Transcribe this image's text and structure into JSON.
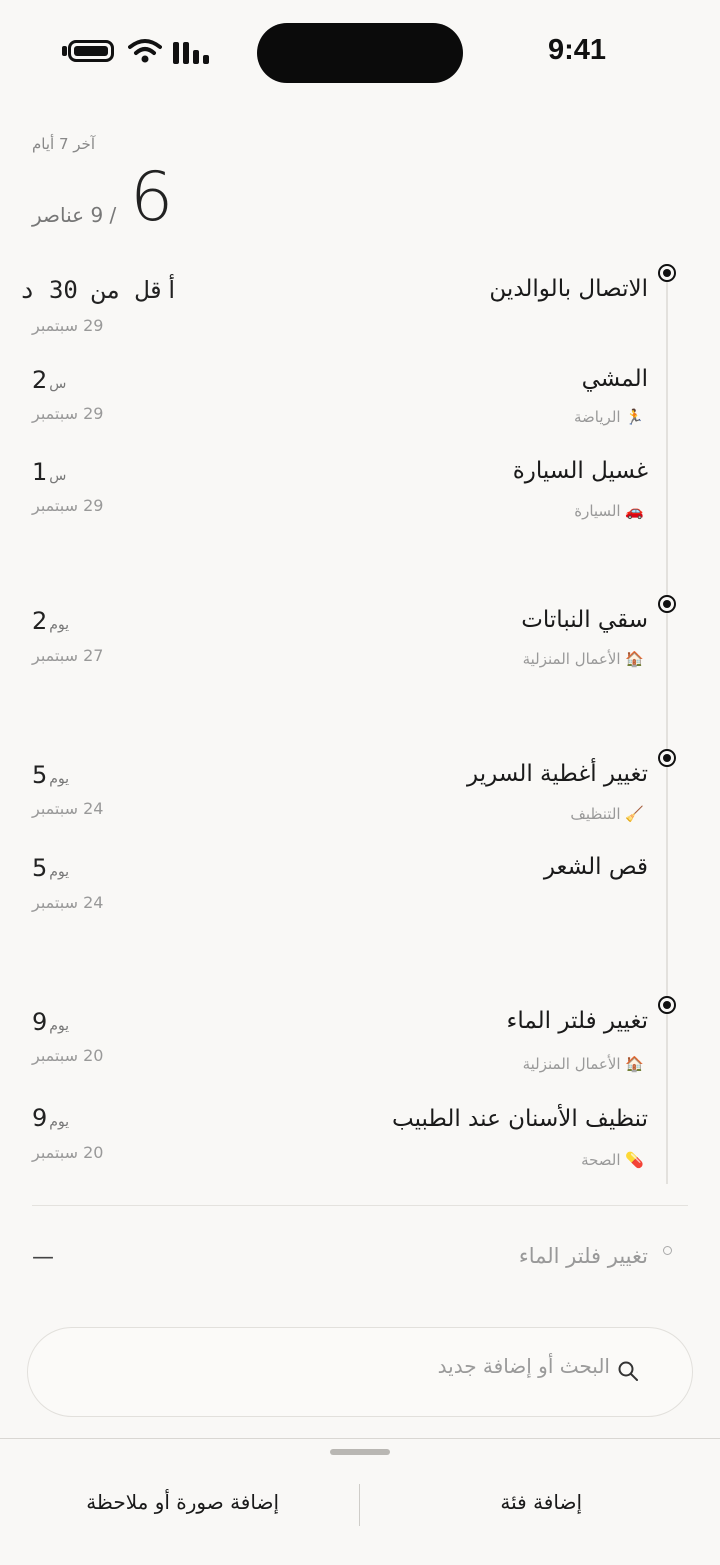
{
  "status_bar": {
    "time": "9:41"
  },
  "header": {
    "period_label": "آخر 7 أيام",
    "done_count": "6",
    "total_label": "/ 9 عناصر"
  },
  "entries": [
    {
      "title": "الاتصال بالوالدين",
      "category": "",
      "amount": "أقل من 30 د",
      "unit": "",
      "date": "29 سبتمبر"
    },
    {
      "title": "المشي",
      "category": "🏃 الرياضة",
      "amount": "2",
      "unit": "س",
      "date": "29 سبتمبر"
    },
    {
      "title": "غسيل السيارة",
      "category": "🚗 السيارة",
      "amount": "1",
      "unit": "س",
      "date": "29 سبتمبر"
    },
    {
      "title": "سقي النباتات",
      "category": "🏠 الأعمال المنزلية",
      "amount": "2",
      "unit": "يوم",
      "date": "27 سبتمبر"
    },
    {
      "title": "تغيير أغطية السرير",
      "category": "🧹 التنظيف",
      "amount": "5",
      "unit": "يوم",
      "date": "24 سبتمبر"
    },
    {
      "title": "قص الشعر",
      "category": "",
      "amount": "5",
      "unit": "يوم",
      "date": "24 سبتمبر"
    },
    {
      "title": "تغيير فلتر الماء",
      "category": "🏠 الأعمال المنزلية",
      "amount": "9",
      "unit": "يوم",
      "date": "20 سبتمبر"
    },
    {
      "title": "تنظيف الأسنان عند الطبيب",
      "category": "💊 الصحة",
      "amount": "9",
      "unit": "يوم",
      "date": "20 سبتمبر"
    }
  ],
  "upcoming": {
    "title": "تغيير فلتر الماء",
    "value": "—"
  },
  "search": {
    "placeholder": "البحث أو إضافة جديد"
  },
  "bottom_sheet": {
    "add_category": "إضافة فئة",
    "add_photo_note": "إضافة صورة أو ملاحظة"
  }
}
